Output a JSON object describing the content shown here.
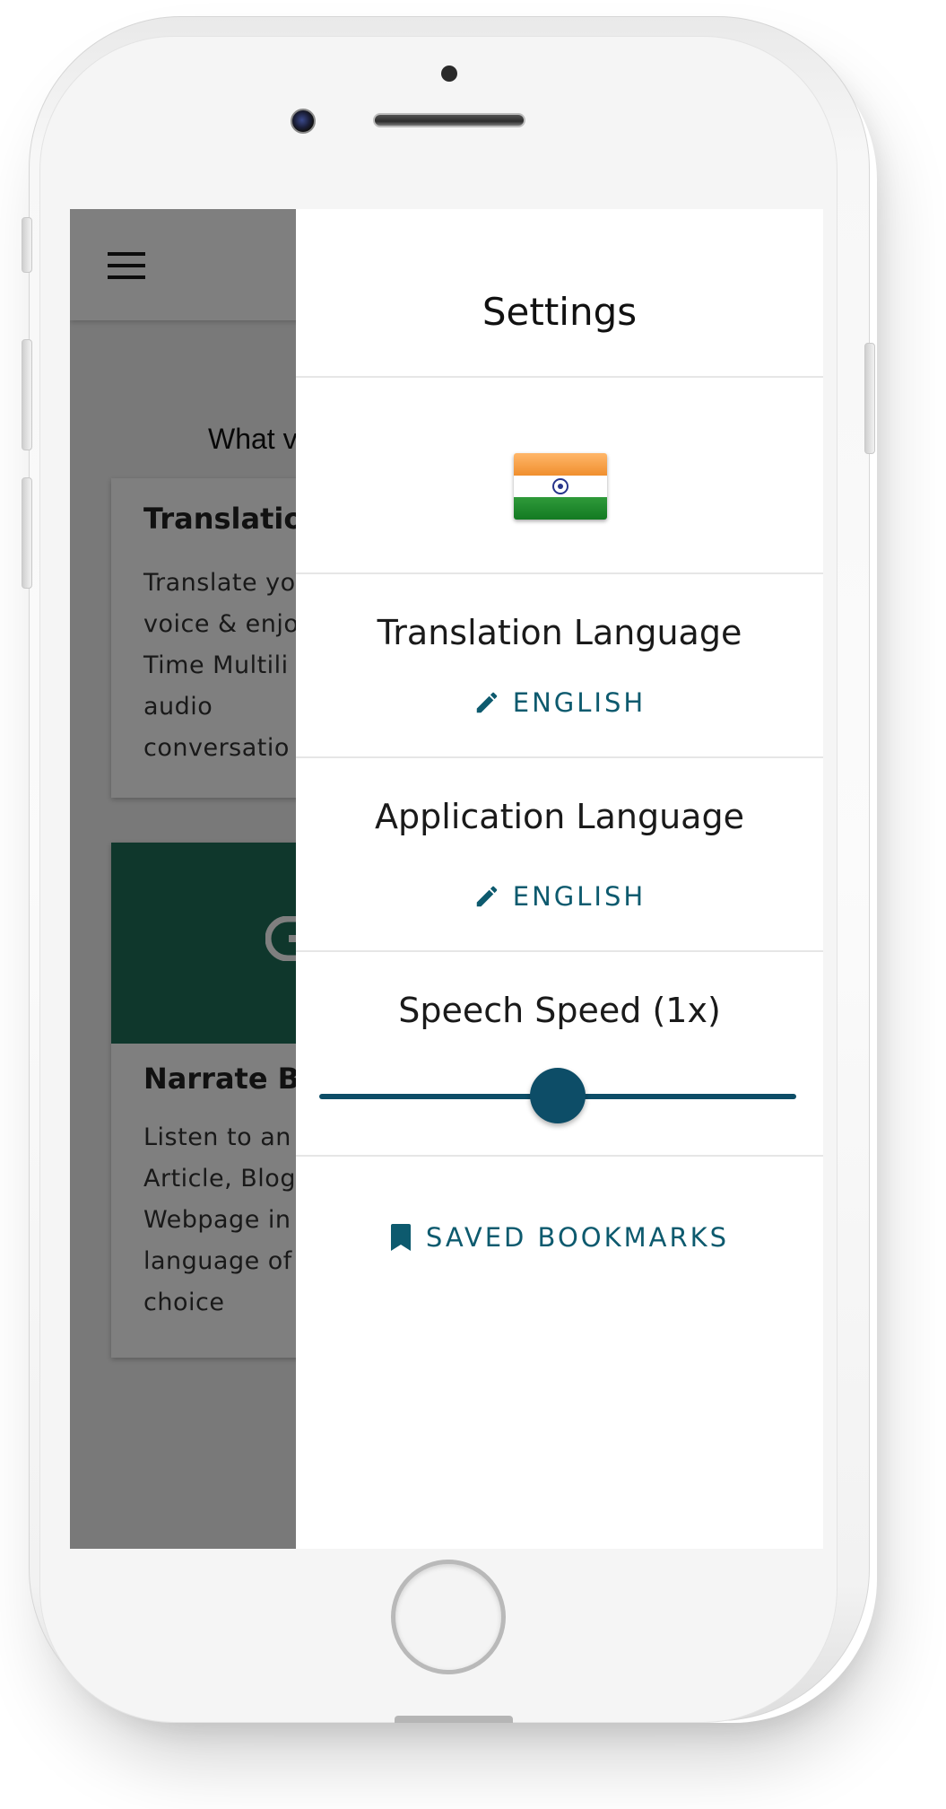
{
  "background_screen": {
    "question_text": "What v",
    "cards": [
      {
        "title": "Translatio",
        "body": "Translate yo voice & enjo Time Multili audio conversatio"
      },
      {
        "title": "Narrate Bl",
        "body": "Listen to an Article, Blog Webpage in language of choice"
      }
    ],
    "banner_color": "#1f6e58"
  },
  "drawer": {
    "title": "Settings",
    "flag": "india-flag",
    "translation_language": {
      "label": "Translation Language",
      "value": "ENGLISH",
      "icon": "pencil-icon"
    },
    "application_language": {
      "label": "Application Language",
      "value": "ENGLISH",
      "icon": "pencil-icon"
    },
    "speech_speed": {
      "label": "Speech Speed (1x)",
      "slider_fraction": 0.5
    },
    "bookmarks": {
      "label": "SAVED BOOKMARKS",
      "icon": "bookmark-icon"
    },
    "accent_color": "#0d5a6e"
  }
}
